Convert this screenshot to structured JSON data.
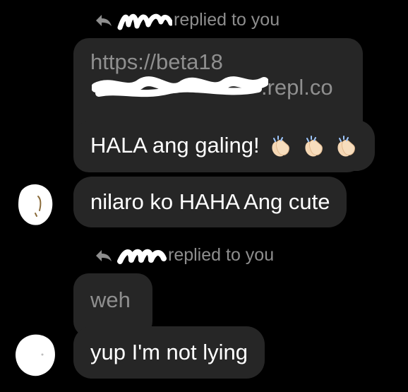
{
  "thread": {
    "reply_1": {
      "header_suffix": "replied to you",
      "quoted_line_1": "https://beta18",
      "quoted_line_2_suffix": ".repl.co",
      "message_1": "HALA ang galing!",
      "message_1_emoji": [
        "clapping-hands",
        "clapping-hands",
        "clapping-hands"
      ],
      "message_2": "nilaro ko HAHA Ang cute"
    },
    "reply_2": {
      "header_suffix": "replied to you",
      "quoted_text": "weh",
      "message_1": "yup I'm not lying"
    }
  },
  "colors": {
    "background": "#000000",
    "bubble": "#262626",
    "quoted_text": "#8f8f8f",
    "header_text": "#8e8e8e",
    "message_text": "#ffffff",
    "scribble": "#ffffff"
  },
  "icons": {
    "reply": "reply-arrow-icon",
    "emoji": "clapping-hands-emoji",
    "avatar": "redacted-avatar"
  }
}
